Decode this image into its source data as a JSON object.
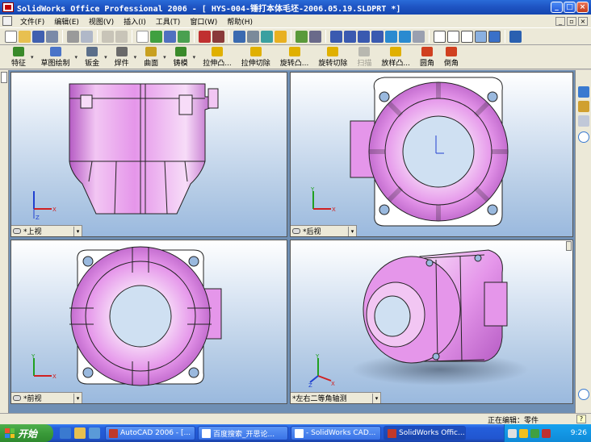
{
  "window": {
    "title": "SolidWorks Office Professional 2006 - [ HYS-004-锤打本体毛坯-2006.05.19.SLDPRT *]",
    "controls": {
      "minimize": "_",
      "maximize": "□",
      "close": "×"
    }
  },
  "menubar": {
    "items": [
      "文件(F)",
      "编辑(E)",
      "视图(V)",
      "插入(I)",
      "工具(T)",
      "窗口(W)",
      "帮助(H)"
    ]
  },
  "feature_toolbar": {
    "items": [
      {
        "label": "特征",
        "color": "#3a8a2a",
        "dropdown": true
      },
      {
        "label": "草图绘制",
        "color": "#4a74c8",
        "dropdown": true
      },
      {
        "label": "钣金",
        "color": "#5b6f8a",
        "dropdown": true
      },
      {
        "label": "焊件",
        "color": "#6a6a6a",
        "dropdown": true
      },
      {
        "label": "曲面",
        "color": "#c8a020",
        "dropdown": true
      },
      {
        "label": "铸模",
        "color": "#3a8a2a",
        "dropdown": true
      },
      {
        "label": "拉伸凸...",
        "color": "#e0b000",
        "dropdown": false
      },
      {
        "label": "拉伸切除",
        "color": "#e0b000",
        "dropdown": false
      },
      {
        "label": "旋转凸...",
        "color": "#e0b000",
        "dropdown": false
      },
      {
        "label": "旋转切除",
        "color": "#e0b000",
        "dropdown": false
      },
      {
        "label": "扫描",
        "color": "#b8b8b0",
        "dropdown": false,
        "disabled": true
      },
      {
        "label": "放样凸...",
        "color": "#e0b000",
        "dropdown": false
      },
      {
        "label": "圆角",
        "color": "#d04020",
        "dropdown": false
      },
      {
        "label": "倒角",
        "color": "#d04020",
        "dropdown": false
      }
    ]
  },
  "viewports": {
    "top": {
      "label": "*上视"
    },
    "back": {
      "label": "*后视"
    },
    "front": {
      "label": "*前视"
    },
    "iso": {
      "label": "*左右二等角轴测"
    }
  },
  "axis_labels": {
    "x": "X",
    "y": "Y",
    "z": "Z"
  },
  "statusbar": {
    "text": "正在编辑：零件",
    "help": "?"
  },
  "taskbar": {
    "start_label": "开始",
    "buttons": [
      {
        "label": "AutoCAD 2006 - [...",
        "active": false,
        "color": "#c0392b"
      },
      {
        "label": "百度搜索_开思论...",
        "active": false,
        "color": "#ffffff"
      },
      {
        "label": "- SolidWorks CAD...",
        "active": false,
        "color": "#ffffff"
      },
      {
        "label": "SolidWorks Offic...",
        "active": true,
        "color": "#c0392b"
      }
    ],
    "clock": "9:26"
  },
  "colors": {
    "part": "#e49ae8",
    "part_dark": "#b660c4",
    "part_light": "#f6d8f7",
    "titlebar": "#1f55c4",
    "axis_x": "#d02020",
    "axis_y": "#20a020",
    "axis_z": "#2040d0"
  }
}
